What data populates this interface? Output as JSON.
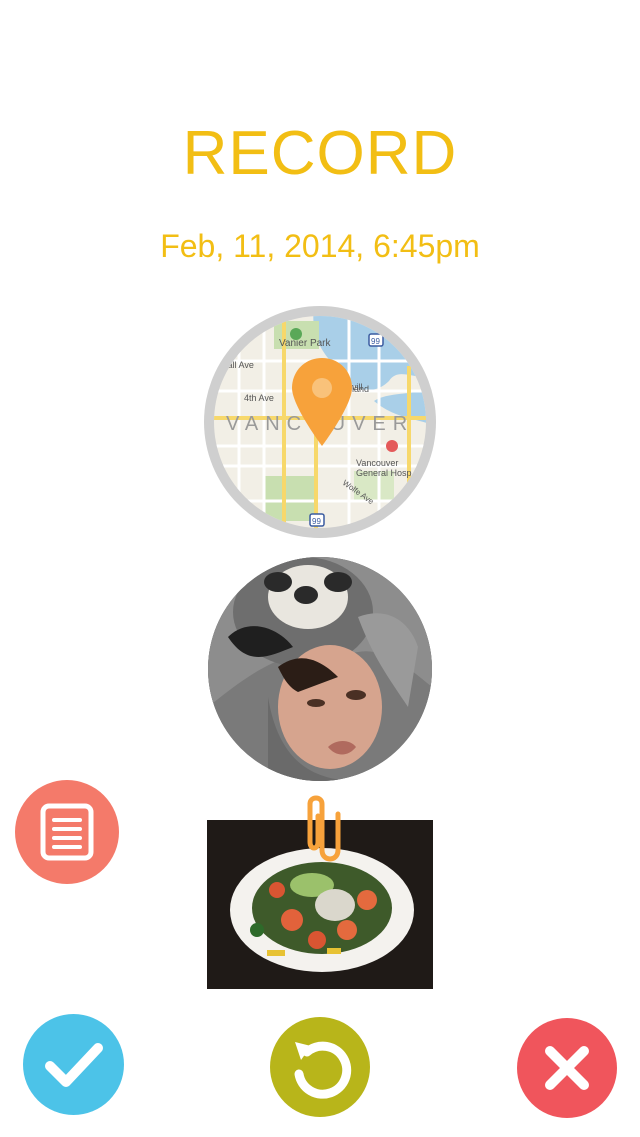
{
  "screen": {
    "title": "RECORD",
    "datetime": "Feb, 11, 2014, 6:45pm"
  },
  "map": {
    "labels": {
      "park": "Vanier Park",
      "city": "VANCOUVER",
      "street1": "4th Ave",
      "street2": "nwall Ave",
      "island": "Granvill",
      "island2": "land",
      "hospital1": "Vancouver",
      "hospital2": "General Hosp",
      "road": "Wolfe Ave",
      "shield_top": "99",
      "shield_bottom": "99"
    }
  },
  "actions": {
    "notes": "notes-icon",
    "confirm": "check-icon",
    "redo": "redo-icon",
    "cancel": "close-icon"
  },
  "colors": {
    "accent": "#F2BE14",
    "pin": "#F7A23B",
    "notes": "#F47A6A",
    "confirm": "#4CC3E8",
    "redo": "#B8B51A",
    "cancel": "#F0555C"
  }
}
